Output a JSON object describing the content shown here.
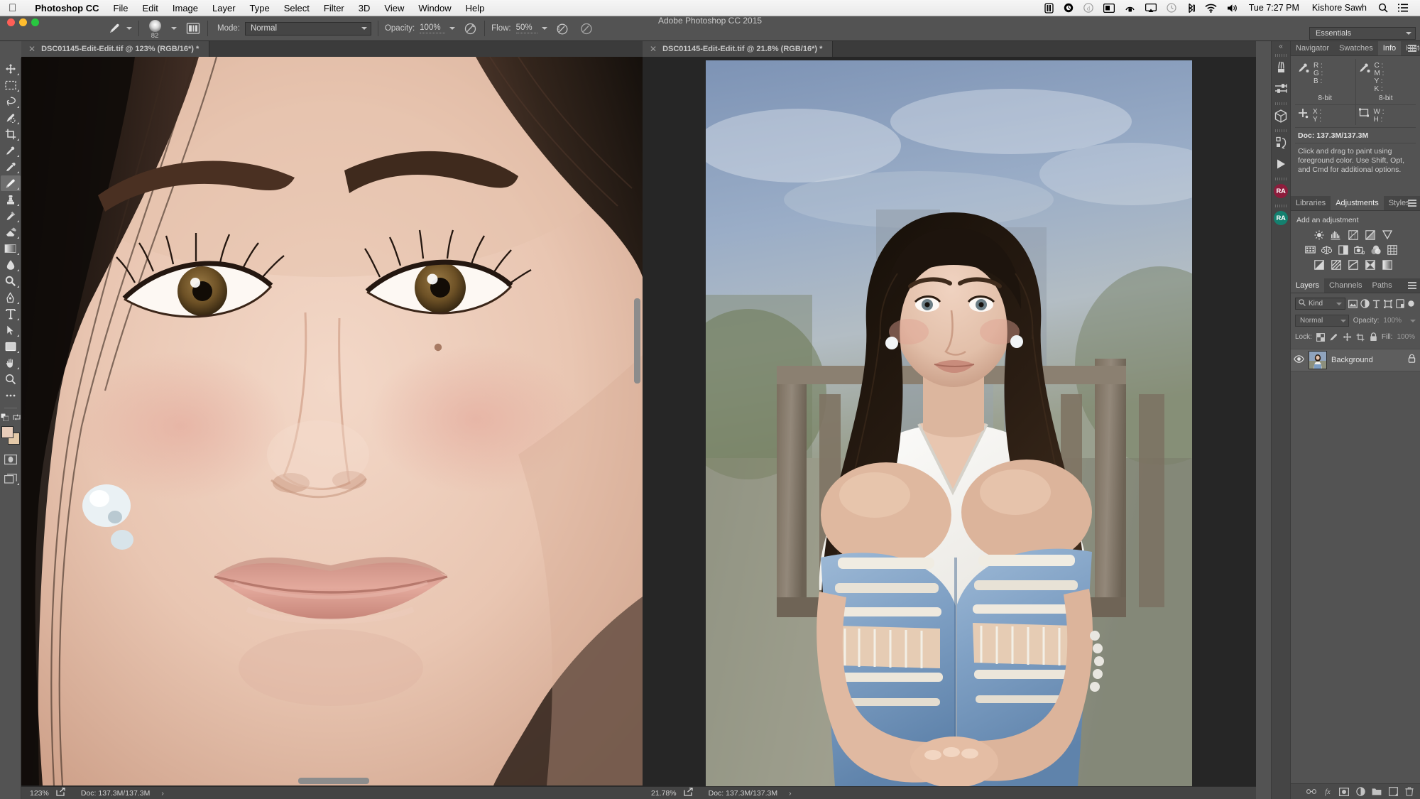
{
  "menubar": {
    "apple_icon": "apple-icon",
    "items": [
      "Photoshop CC",
      "File",
      "Edit",
      "Image",
      "Layer",
      "Type",
      "Select",
      "Filter",
      "3D",
      "View",
      "Window",
      "Help"
    ],
    "status_icons": [
      "battery-icon",
      "timemachine-icon",
      "dropbox-icon",
      "display-icon",
      "vpn-lock-icon",
      "airplay-icon",
      "clock-history-icon",
      "bluetooth-icon",
      "wifi-icon",
      "volume-icon"
    ],
    "time": "Tue 7:27 PM",
    "user": "Kishore Sawh",
    "search_icon": "search-icon",
    "notification_icon": "notification-center-icon"
  },
  "window": {
    "title": "Adobe Photoshop CC 2015"
  },
  "options_bar": {
    "tool_icon": "brush-tool-icon",
    "brush_size": "82",
    "brush_settings_icon": "brush-panel-icon",
    "mode_label": "Mode:",
    "mode_value": "Normal",
    "opacity_label": "Opacity:",
    "opacity_value": "100%",
    "opacity_pressure_icon": "pressure-opacity-icon",
    "flow_label": "Flow:",
    "flow_value": "50%",
    "airbrush_icon": "airbrush-icon",
    "pressure_size_icon": "pressure-size-icon"
  },
  "workspace": {
    "label": "Essentials"
  },
  "documents": [
    {
      "tab_label": "DSC01145-Edit-Edit.tif @ 123% (RGB/16*) *",
      "close_icon": "close-icon",
      "zoom": "123%",
      "doc_size": "Doc: 137.3M/137.3M",
      "expand_icon": "status-arrow-icon",
      "share_icon": "share-icon"
    },
    {
      "tab_label": "DSC01145-Edit-Edit.tif @ 21.8% (RGB/16*) *",
      "close_icon": "close-icon",
      "zoom": "21.78%",
      "doc_size": "Doc: 137.3M/137.3M",
      "expand_icon": "status-arrow-icon",
      "share_icon": "share-icon"
    }
  ],
  "toolbar": {
    "tools": [
      {
        "name": "move-tool",
        "has_flyout": true
      },
      {
        "name": "rectangular-marquee-tool",
        "has_flyout": true
      },
      {
        "name": "lasso-tool",
        "has_flyout": true
      },
      {
        "name": "quick-selection-tool",
        "has_flyout": true
      },
      {
        "name": "crop-tool",
        "has_flyout": true
      },
      {
        "name": "eyedropper-tool",
        "has_flyout": true
      },
      {
        "name": "spot-healing-brush-tool",
        "has_flyout": true
      },
      {
        "name": "brush-tool",
        "has_flyout": true,
        "active": true
      },
      {
        "name": "clone-stamp-tool",
        "has_flyout": true
      },
      {
        "name": "history-brush-tool",
        "has_flyout": true
      },
      {
        "name": "eraser-tool",
        "has_flyout": true
      },
      {
        "name": "gradient-tool",
        "has_flyout": true
      },
      {
        "name": "blur-tool",
        "has_flyout": true
      },
      {
        "name": "dodge-tool",
        "has_flyout": true
      },
      {
        "name": "pen-tool",
        "has_flyout": true
      },
      {
        "name": "type-tool",
        "has_flyout": true
      },
      {
        "name": "path-selection-tool",
        "has_flyout": true
      },
      {
        "name": "rectangle-tool",
        "has_flyout": true
      },
      {
        "name": "hand-tool",
        "has_flyout": true
      },
      {
        "name": "zoom-tool",
        "has_flyout": false
      },
      {
        "name": "edit-toolbar-ellipsis",
        "has_flyout": false
      }
    ],
    "foreground_color": "#e9cdba",
    "background_color": "#e4c9a8",
    "default_colors_icon": "default-colors-icon",
    "swap_colors_icon": "swap-colors-icon",
    "quick_mask_icon": "quick-mask-icon",
    "screen_mode_icon": "screen-mode-icon"
  },
  "dock_strip": {
    "collapse_icon": "collapse-panels-icon",
    "items": [
      "brush-presets-icon",
      "brush-settings-icon",
      "3d-cube-icon",
      "history-icon",
      "play-action-icon",
      "retouching-academy-icon",
      "retouching-academy-panel-icon"
    ],
    "badge_1_text": "RA",
    "badge_1_color": "#8c1d3c",
    "badge_2_text": "RA",
    "badge_2_color": "#14806f"
  },
  "info_panel": {
    "tabs": [
      "Navigator",
      "Swatches",
      "Info",
      "Histogram"
    ],
    "active_tab": "Info",
    "menu_icon": "panel-menu-icon",
    "eyedropper1_icon": "eyedropper-readout-icon",
    "eyedropper2_icon": "eyedropper-readout-icon",
    "rgb_labels": [
      "R :",
      "G :",
      "B :"
    ],
    "cmyk_labels": [
      "C :",
      "M :",
      "Y :",
      "K :"
    ],
    "bit_left": "8-bit",
    "bit_right": "8-bit",
    "coords_icon": "crosshair-icon",
    "coord_labels": [
      "X :",
      "Y :"
    ],
    "size_icon": "marquee-size-icon",
    "size_labels": [
      "W :",
      "H :"
    ],
    "doc_line": "Doc: 137.3M/137.3M",
    "hint": "Click and drag to paint using foreground color.  Use Shift, Opt, and Cmd for additional options."
  },
  "adjustments_panel": {
    "tabs": [
      "Libraries",
      "Adjustments",
      "Styles"
    ],
    "active_tab": "Adjustments",
    "menu_icon": "panel-menu-icon",
    "title": "Add an adjustment",
    "row1": [
      "brightness-contrast-icon",
      "levels-icon",
      "curves-icon",
      "exposure-icon",
      "vibrance-icon"
    ],
    "row2": [
      "hue-saturation-icon",
      "color-balance-icon",
      "black-white-icon",
      "photo-filter-icon",
      "channel-mixer-icon",
      "color-lookup-icon"
    ],
    "row3": [
      "invert-icon",
      "posterize-icon",
      "threshold-icon",
      "selective-color-icon",
      "gradient-map-icon"
    ]
  },
  "layers_panel": {
    "tabs": [
      "Layers",
      "Channels",
      "Paths"
    ],
    "active_tab": "Layers",
    "menu_icon": "panel-menu-icon",
    "filter_label": "Kind",
    "filter_search_icon": "search-icon",
    "filter_icons": [
      "filter-pixel-icon",
      "filter-adjustment-icon",
      "filter-type-icon",
      "filter-shape-icon",
      "filter-smart-icon"
    ],
    "filter_toggle_icon": "filter-toggle-icon",
    "blend_mode": "Normal",
    "opacity_label": "Opacity:",
    "opacity_value": "100%",
    "lock_label": "Lock:",
    "lock_icons": [
      "lock-transparent-pixels-icon",
      "lock-image-pixels-icon",
      "lock-position-icon",
      "lock-artboard-nesting-icon",
      "lock-all-icon"
    ],
    "fill_label": "Fill:",
    "fill_value": "100%",
    "layers": [
      {
        "name": "Background",
        "visibility_icon": "eye-icon",
        "visible": true,
        "lock_icon": "lock-icon",
        "locked": true
      }
    ],
    "bottom_icons": [
      "link-layers-icon",
      "layer-style-fx-icon",
      "add-layer-mask-icon",
      "new-adjustment-layer-icon",
      "new-group-icon",
      "new-layer-icon",
      "delete-layer-icon"
    ]
  },
  "colors": {
    "canvas_bg": "#262626",
    "panel_bg": "#535353",
    "panel_dark": "#454545",
    "text": "#d4d4d4"
  }
}
